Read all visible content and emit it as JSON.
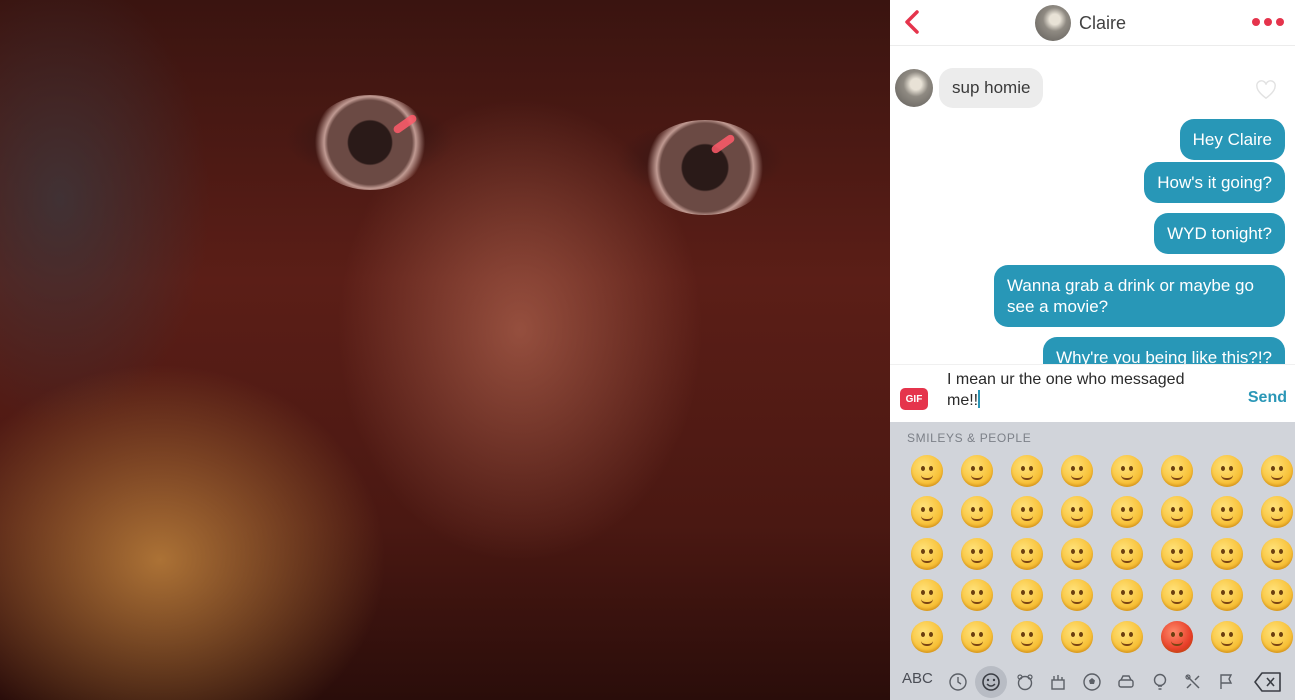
{
  "header": {
    "contact_name": "Claire",
    "back_icon": "chevron-left-icon",
    "menu_icon": "more-dots-icon",
    "accent_color": "#e5344c"
  },
  "messages": [
    {
      "direction": "incoming",
      "text": "sup homie"
    },
    {
      "direction": "outgoing",
      "text": "Hey Claire"
    },
    {
      "direction": "outgoing",
      "text": "How's it going?"
    },
    {
      "direction": "outgoing",
      "text": "WYD tonight?"
    },
    {
      "direction": "outgoing",
      "text": "Wanna grab a drink or maybe go see a movie?"
    },
    {
      "direction": "outgoing",
      "text": "Why're you being like this?!?"
    }
  ],
  "composer": {
    "gif_label": "GIF",
    "input_value": "I mean ur the one who messaged me!!",
    "send_label": "Send",
    "outgoing_color": "#2897b7"
  },
  "keyboard": {
    "section_title": "SMILEYS & PEOPLE",
    "abc_label": "ABC",
    "emoji_rows": 5,
    "emoji_cols": 8,
    "categories": [
      "clock-icon",
      "smiley-icon",
      "animal-icon",
      "food-icon",
      "ball-icon",
      "car-icon",
      "bulb-icon",
      "symbols-icon",
      "flag-icon"
    ],
    "active_category": "smiley-icon",
    "delete_icon": "backspace-icon"
  }
}
